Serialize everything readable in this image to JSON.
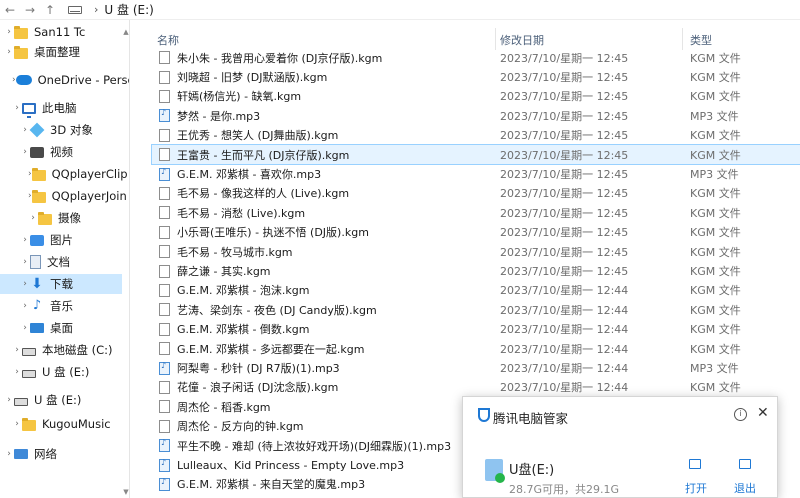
{
  "address": {
    "path": "U 盘 (E:)"
  },
  "nav": [
    {
      "label": "San11 Tc",
      "icon": "folder-icon"
    },
    {
      "label": "桌面整理",
      "icon": "folder-icon"
    },
    {
      "label": "OneDrive - Persc",
      "icon": "cloud-icon"
    },
    {
      "label": "此电脑",
      "icon": "computer-icon"
    },
    {
      "label": "3D 对象",
      "icon": "3d-objects-icon"
    },
    {
      "label": "视频",
      "icon": "video-icon"
    },
    {
      "label": "QQplayerClip",
      "icon": "folder-icon"
    },
    {
      "label": "QQplayerJoin",
      "icon": "folder-icon"
    },
    {
      "label": "摄像",
      "icon": "folder-icon"
    },
    {
      "label": "图片",
      "icon": "pictures-icon"
    },
    {
      "label": "文档",
      "icon": "documents-icon"
    },
    {
      "label": "下载",
      "icon": "download-icon"
    },
    {
      "label": "音乐",
      "icon": "music-icon"
    },
    {
      "label": "桌面",
      "icon": "desktop-icon"
    },
    {
      "label": "本地磁盘 (C:)",
      "icon": "drive-icon"
    },
    {
      "label": "U 盘 (E:)",
      "icon": "usb-drive-icon"
    },
    {
      "label": "U 盘 (E:)",
      "icon": "usb-drive-icon"
    },
    {
      "label": "KugouMusic",
      "icon": "folder-icon"
    },
    {
      "label": "网络",
      "icon": "network-icon"
    }
  ],
  "columns": {
    "name": "名称",
    "date": "修改日期",
    "type": "类型"
  },
  "files": [
    {
      "name": "朱小朱 - 我曾用心爱着你 (DJ京仔版).kgm",
      "date": "2023/7/10/星期一 12:45",
      "type": "KGM 文件",
      "kind": "kgm"
    },
    {
      "name": "刘晓超 - 旧梦 (DJ默涵版).kgm",
      "date": "2023/7/10/星期一 12:45",
      "type": "KGM 文件",
      "kind": "kgm"
    },
    {
      "name": "轩嫣(杨信光) - 缺氧.kgm",
      "date": "2023/7/10/星期一 12:45",
      "type": "KGM 文件",
      "kind": "kgm"
    },
    {
      "name": "梦然 - 是你.mp3",
      "date": "2023/7/10/星期一 12:45",
      "type": "MP3 文件",
      "kind": "mp3"
    },
    {
      "name": "王优秀 - 想笑人 (DJ舞曲版).kgm",
      "date": "2023/7/10/星期一 12:45",
      "type": "KGM 文件",
      "kind": "kgm"
    },
    {
      "name": "王富贵 - 生而平凡 (DJ京仔版).kgm",
      "date": "2023/7/10/星期一 12:45",
      "type": "KGM 文件",
      "kind": "kgm"
    },
    {
      "name": "G.E.M. 邓紫棋 - 喜欢你.mp3",
      "date": "2023/7/10/星期一 12:45",
      "type": "MP3 文件",
      "kind": "mp3"
    },
    {
      "name": "毛不易 - 像我这样的人 (Live).kgm",
      "date": "2023/7/10/星期一 12:45",
      "type": "KGM 文件",
      "kind": "kgm"
    },
    {
      "name": "毛不易 - 消愁 (Live).kgm",
      "date": "2023/7/10/星期一 12:45",
      "type": "KGM 文件",
      "kind": "kgm"
    },
    {
      "name": "小乐哥(王唯乐) - 执迷不悟 (DJ版).kgm",
      "date": "2023/7/10/星期一 12:45",
      "type": "KGM 文件",
      "kind": "kgm"
    },
    {
      "name": "毛不易 - 牧马城市.kgm",
      "date": "2023/7/10/星期一 12:45",
      "type": "KGM 文件",
      "kind": "kgm"
    },
    {
      "name": "薛之谦 - 其实.kgm",
      "date": "2023/7/10/星期一 12:45",
      "type": "KGM 文件",
      "kind": "kgm"
    },
    {
      "name": "G.E.M. 邓紫棋 - 泡沫.kgm",
      "date": "2023/7/10/星期一 12:44",
      "type": "KGM 文件",
      "kind": "kgm"
    },
    {
      "name": "艺涛、梁剑东 - 夜色 (DJ Candy版).kgm",
      "date": "2023/7/10/星期一 12:44",
      "type": "KGM 文件",
      "kind": "kgm"
    },
    {
      "name": "G.E.M. 邓紫棋 - 倒数.kgm",
      "date": "2023/7/10/星期一 12:44",
      "type": "KGM 文件",
      "kind": "kgm"
    },
    {
      "name": "G.E.M. 邓紫棋 - 多远都要在一起.kgm",
      "date": "2023/7/10/星期一 12:44",
      "type": "KGM 文件",
      "kind": "kgm"
    },
    {
      "name": "阿梨粤 - 秒针 (DJ R7版)(1).mp3",
      "date": "2023/7/10/星期一 12:44",
      "type": "MP3 文件",
      "kind": "mp3"
    },
    {
      "name": "花僮 - 浪子闲话 (DJ沈念版).kgm",
      "date": "2023/7/10/星期一 12:44",
      "type": "KGM 文件",
      "kind": "kgm"
    },
    {
      "name": "周杰伦 - 稻香.kgm",
      "date": "",
      "type": "",
      "kind": "kgm"
    },
    {
      "name": "周杰伦 - 反方向的钟.kgm",
      "date": "",
      "type": "",
      "kind": "kgm"
    },
    {
      "name": "平生不晚 - 难却 (待上浓妆好戏开场)(DJ细霖版)(1).mp3",
      "date": "",
      "type": "",
      "kind": "mp3"
    },
    {
      "name": "Lulleaux、Kid Princess - Empty Love.mp3",
      "date": "",
      "type": "",
      "kind": "mp3"
    },
    {
      "name": "G.E.M. 邓紫棋 - 来自天堂的魔鬼.mp3",
      "date": "",
      "type": "",
      "kind": "mp3"
    }
  ],
  "popup": {
    "title": "腾讯电脑管家",
    "drive_name": "U盘(E:)",
    "capacity": "28.7G可用，共29.1G",
    "open_label": "打开",
    "eject_label": "退出",
    "accent": "#1e78d4"
  }
}
